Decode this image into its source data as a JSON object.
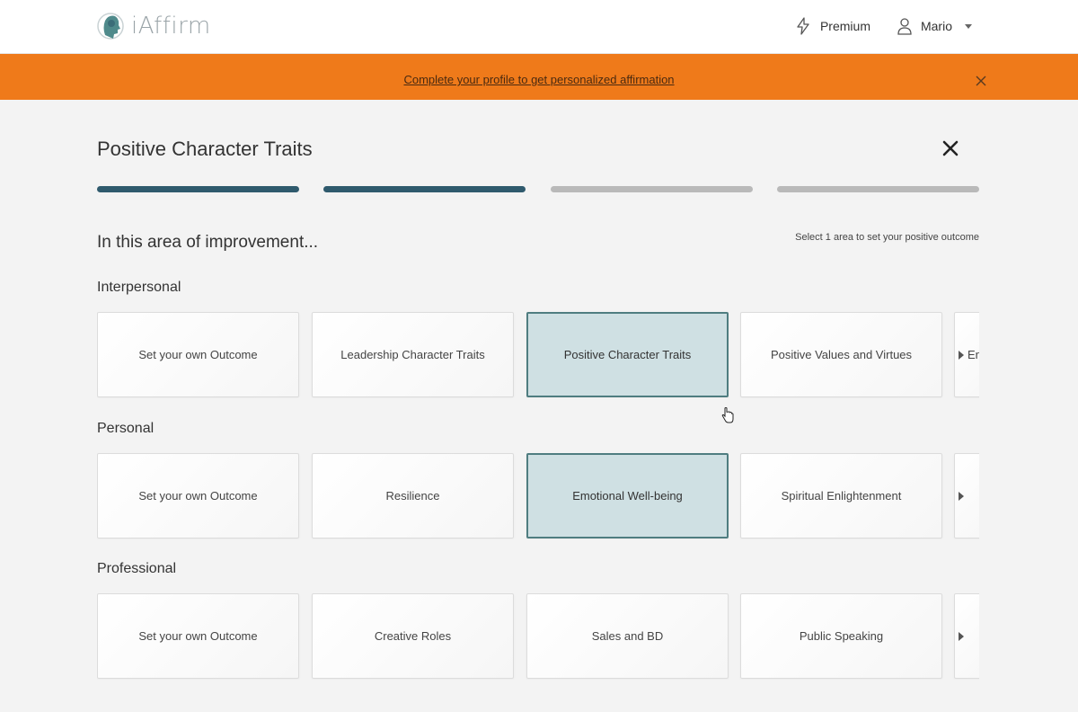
{
  "app": {
    "name": "iAffirm"
  },
  "header": {
    "premium_label": "Premium",
    "user_name": "Mario"
  },
  "banner": {
    "link_text": "Complete your profile to get personalized affirmation"
  },
  "page": {
    "title": "Positive Character Traits",
    "subheading": "In this area of improvement...",
    "hint": "Select 1 area to set your positive outcome",
    "progress": {
      "steps_total": 4,
      "steps_completed": 2
    }
  },
  "colors": {
    "accent": "#2f5a6d",
    "banner": "#ef7a1a",
    "selected_bg": "#cfe0e3",
    "selected_border": "#4f7d80"
  },
  "sections": [
    {
      "label": "Interpersonal",
      "cards": [
        "Set your own Outcome",
        "Leadership Character Traits",
        "Positive Character Traits",
        "Positive Values and Virtues"
      ],
      "partial": "En",
      "selected_index": 2
    },
    {
      "label": "Personal",
      "cards": [
        "Set your own Outcome",
        "Resilience",
        "Emotional Well-being",
        "Spiritual Enlightenment"
      ],
      "partial": "",
      "selected_index": 2
    },
    {
      "label": "Professional",
      "cards": [
        "Set your own Outcome",
        "Creative Roles",
        "Sales and BD",
        "Public Speaking"
      ],
      "partial": "",
      "selected_index": -1
    }
  ]
}
